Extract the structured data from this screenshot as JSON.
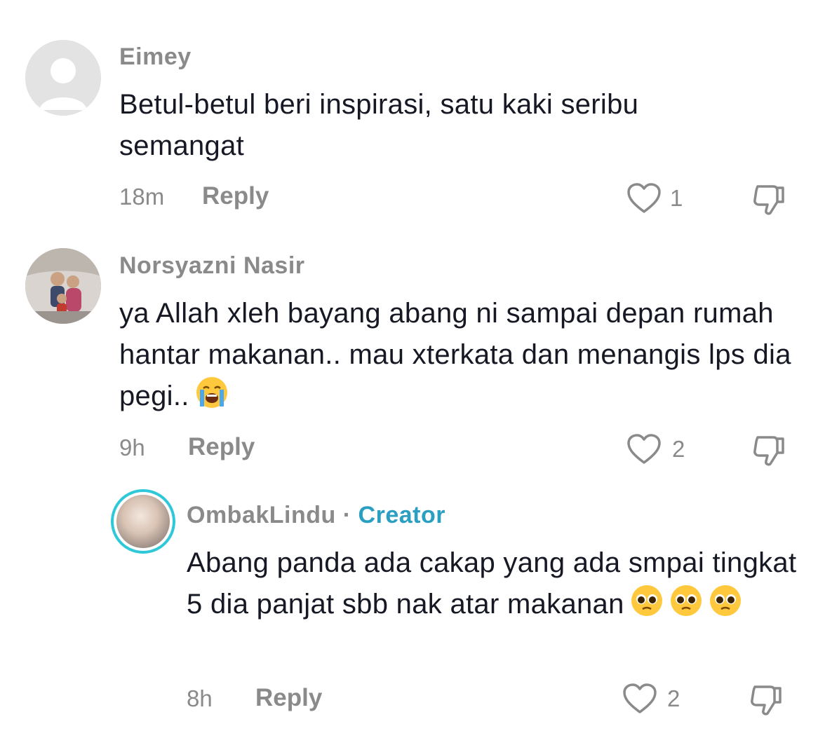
{
  "comments": [
    {
      "username": "Eimey",
      "text": "Betul-betul beri inspirasi, satu kaki seribu semangat",
      "time": "18m",
      "reply_label": "Reply",
      "likes": "1",
      "avatar_icon": "default-avatar-icon"
    },
    {
      "username": "Norsyazni Nasir",
      "text": "ya Allah xleh bayang abang ni sampai depan rumah hantar makanan.. mau xterkata dan menangis lps dia pegi..",
      "emoji": "loudly-crying-face-icon",
      "time": "9h",
      "reply_label": "Reply",
      "likes": "2",
      "avatar_icon": "family-photo-avatar"
    },
    {
      "username": "OmbakLindu",
      "separator": "·",
      "creator_label": "Creator",
      "text": "Abang panda ada cakap yang ada smpai tingkat 5 dia panjat sbb nak atar makanan",
      "emoji": "pleading-face-icon",
      "time": "8h",
      "reply_label": "Reply",
      "likes": "2",
      "avatar_icon": "creator-photo-avatar"
    }
  ],
  "colors": {
    "text": "#161823",
    "muted": "#8a8a8a",
    "creator": "#2a9fc2",
    "creator_ring": "#2ec8d8"
  }
}
